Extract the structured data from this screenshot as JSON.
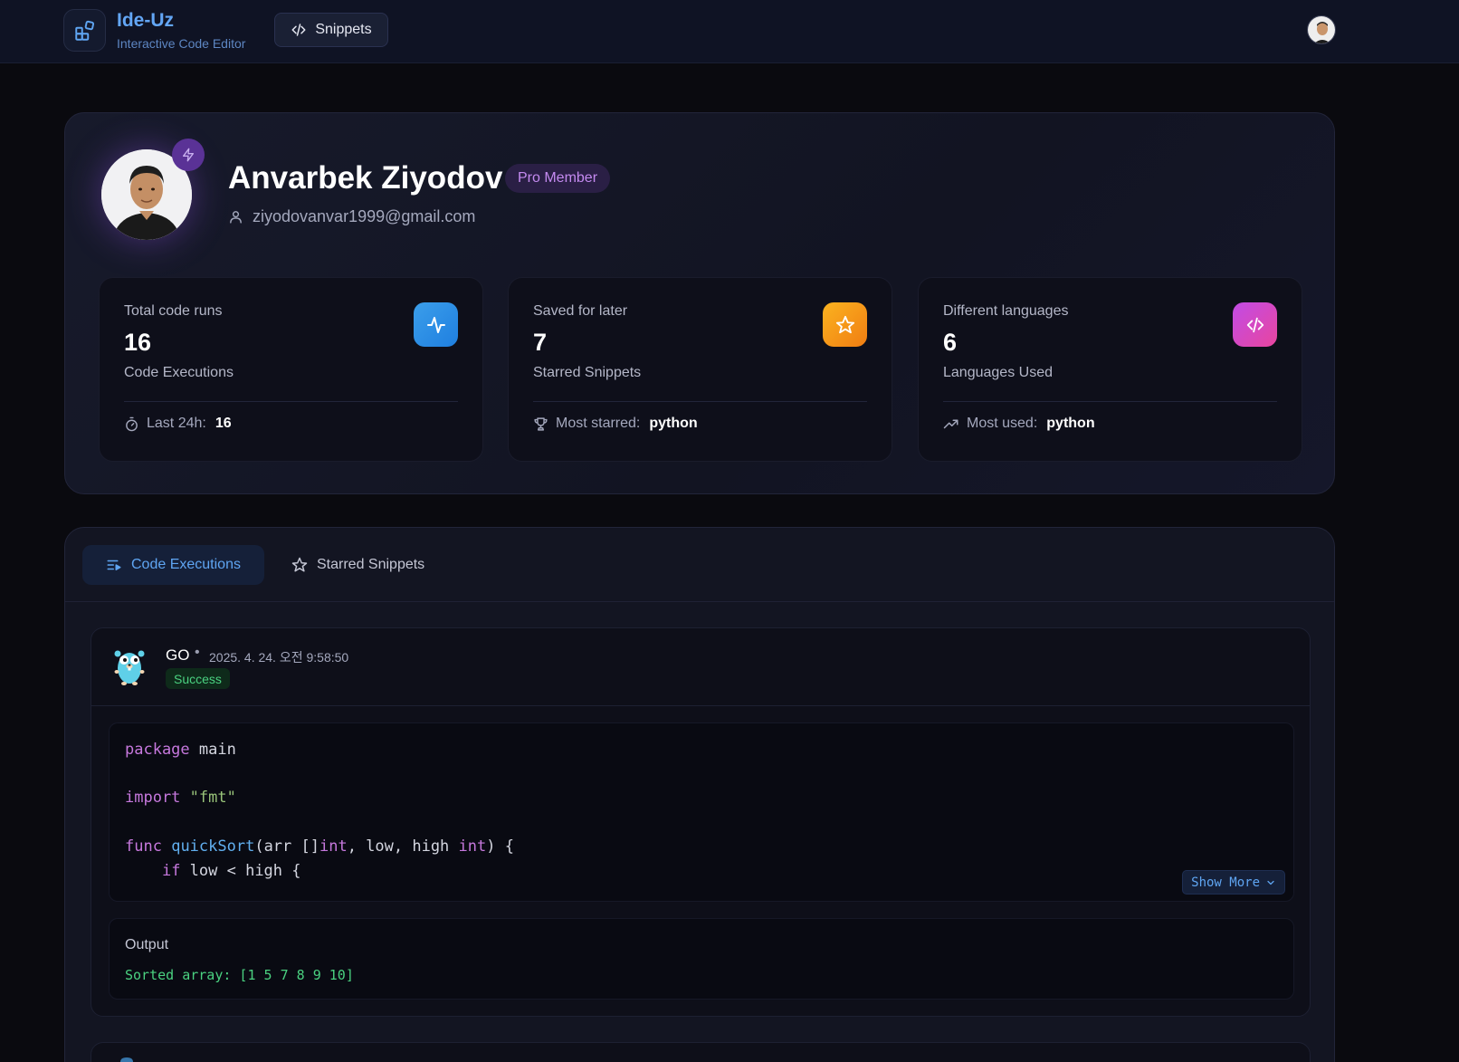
{
  "header": {
    "brand_title": "Ide-Uz",
    "brand_subtitle": "Interactive Code Editor",
    "snippets_label": "Snippets"
  },
  "profile": {
    "name": "Anvarbek Ziyodov",
    "badge": "Pro Member",
    "email": "ziyodovanvar1999@gmail.com"
  },
  "stats": [
    {
      "label": "Total code runs",
      "value": "16",
      "description": "Code Executions",
      "footer_label": "Last 24h:",
      "footer_value": "16",
      "icon": "activity-icon",
      "color_from": "#3b9eea",
      "color_to": "#1f7fe0"
    },
    {
      "label": "Saved for later",
      "value": "7",
      "description": "Starred Snippets",
      "footer_label": "Most starred:",
      "footer_value": "python",
      "icon": "star-icon",
      "color_from": "#fbb320",
      "color_to": "#f07d12"
    },
    {
      "label": "Different languages",
      "value": "6",
      "description": "Languages Used",
      "footer_label": "Most used:",
      "footer_value": "python",
      "icon": "code-icon",
      "color_from": "#c14ce6",
      "color_to": "#e9459e"
    }
  ],
  "tabs": [
    {
      "label": "Code Executions",
      "active": true
    },
    {
      "label": "Starred Snippets",
      "active": false
    }
  ],
  "executions": [
    {
      "language": "GO",
      "timestamp": "2025. 4. 24. 오전 9:58:50",
      "status": "Success",
      "code_lines": [
        "package main",
        "",
        "import \"fmt\"",
        "",
        "func quickSort(arr []int, low, high int) {",
        "    if low < high {"
      ],
      "show_more_label": "Show More",
      "output_label": "Output",
      "output": "Sorted array: [1 5 7 8 9 10]"
    }
  ],
  "colors": {
    "accent_blue": "#5fa5f2",
    "pro_purple": "#c48af0",
    "success_green": "#4ad180"
  }
}
